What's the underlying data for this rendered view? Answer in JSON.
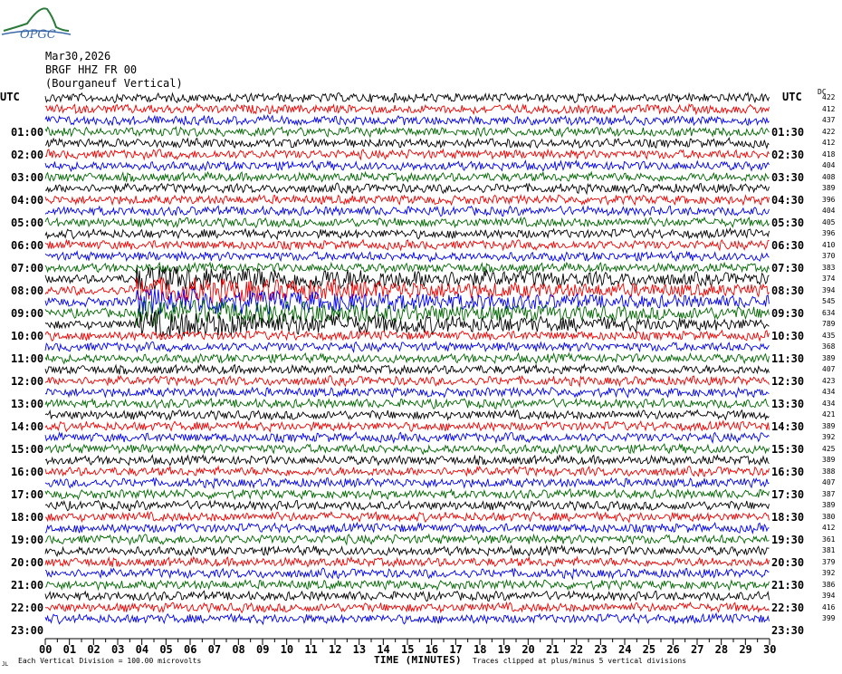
{
  "logo": {
    "text": "OPGC",
    "icon": "mountain-logo-icon"
  },
  "header": {
    "date": "Mar30,2026",
    "station": "BRGF HHZ FR 00",
    "location": "(Bourganeuf Vertical)"
  },
  "utc_left": "UTC",
  "utc_right": "UTC",
  "dc_label": "DC",
  "footer": {
    "vertical_division": "Each Vertical Division =  100.00 microvolts",
    "xlabel": "TIME (MINUTES)",
    "clip_note": "Traces clipped at plus/minus 5 vertical divisions",
    "mark": "JL"
  },
  "colors": {
    "trace1": "#000000",
    "trace2": "#ee0000",
    "trace3": "#0000ee",
    "trace4": "#006600"
  },
  "chart_data": {
    "type": "line",
    "title": "",
    "xlabel": "TIME (MINUTES)",
    "xlim": [
      0,
      30
    ],
    "x_ticks": [
      "00",
      "01",
      "02",
      "03",
      "04",
      "05",
      "06",
      "07",
      "08",
      "09",
      "10",
      "11",
      "12",
      "13",
      "14",
      "15",
      "16",
      "17",
      "18",
      "19",
      "20",
      "21",
      "22",
      "23",
      "24",
      "25",
      "26",
      "27",
      "28",
      "29",
      "30"
    ],
    "left_hour_labels": [
      "01:00",
      "02:00",
      "03:00",
      "04:00",
      "05:00",
      "06:00",
      "07:00",
      "08:00",
      "09:00",
      "10:00",
      "11:00",
      "12:00",
      "13:00",
      "14:00",
      "15:00",
      "16:00",
      "17:00",
      "18:00",
      "19:00",
      "20:00",
      "21:00",
      "22:00",
      "23:00"
    ],
    "right_hour_labels": [
      "01:30",
      "02:30",
      "03:30",
      "04:30",
      "05:30",
      "06:30",
      "07:30",
      "08:30",
      "09:30",
      "10:30",
      "11:30",
      "12:30",
      "13:30",
      "14:30",
      "15:30",
      "16:30",
      "17:30",
      "18:30",
      "19:30",
      "20:30",
      "21:30",
      "22:30",
      "23:30"
    ],
    "dc_offsets": [
      422,
      412,
      437,
      422,
      412,
      418,
      404,
      408,
      389,
      396,
      404,
      405,
      396,
      410,
      370,
      383,
      374,
      394,
      545,
      634,
      789,
      435,
      368,
      389,
      407,
      423,
      434,
      434,
      421,
      389,
      392,
      425,
      389,
      388,
      407,
      387,
      389,
      380,
      412,
      361,
      381,
      379,
      392,
      386,
      394,
      416,
      399
    ],
    "event": {
      "start_minute": 3.8,
      "peak_traces": [
        16,
        17,
        18,
        19,
        20
      ],
      "description": "large amplitude event"
    }
  }
}
